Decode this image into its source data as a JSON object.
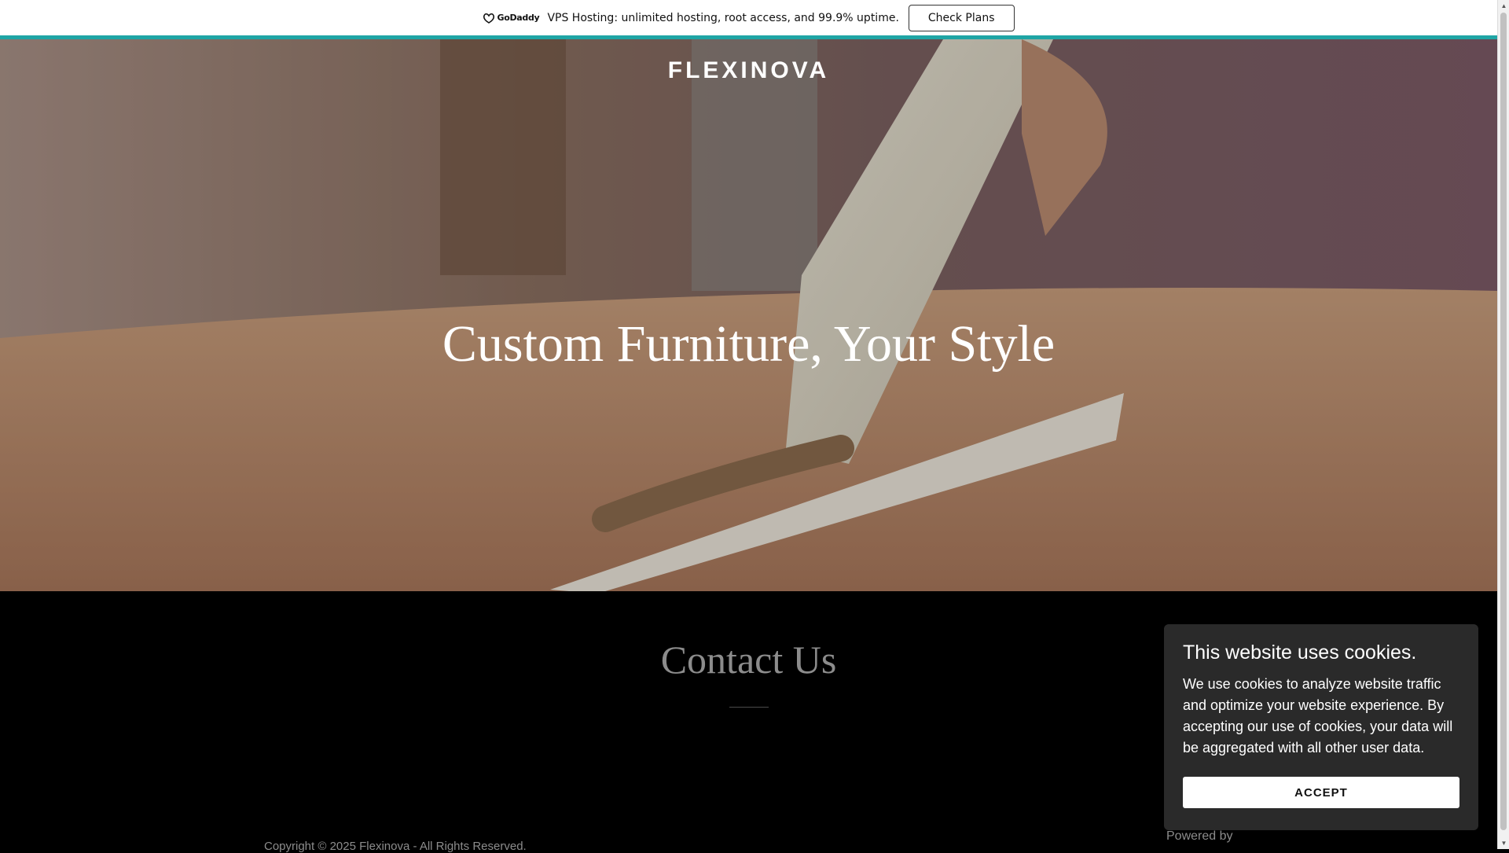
{
  "promo": {
    "logo_text": "GoDaddy",
    "text": "VPS Hosting: unlimited hosting, root access, and 99.9% uptime.",
    "button_label": "Check Plans",
    "accent_color": "#1fa5a5"
  },
  "hero": {
    "brand": "FLEXINOVA",
    "headline": "Custom Furniture, Your Style"
  },
  "contact": {
    "title": "Contact Us"
  },
  "footer": {
    "copyright": "Copyright © 2025 Flexinova - All Rights Reserved.",
    "powered_by": "Powered by"
  },
  "cookie": {
    "title": "This website uses cookies.",
    "body": "We use cookies to analyze website traffic and optimize your website experience. By accepting our use of cookies, your data will be aggregated with all other user data.",
    "accept_label": "ACCEPT"
  },
  "icons": {
    "logo": "godaddy-logo-icon",
    "scroll_up": "scroll-up-arrow-icon",
    "scroll_down": "scroll-down-arrow-icon"
  }
}
